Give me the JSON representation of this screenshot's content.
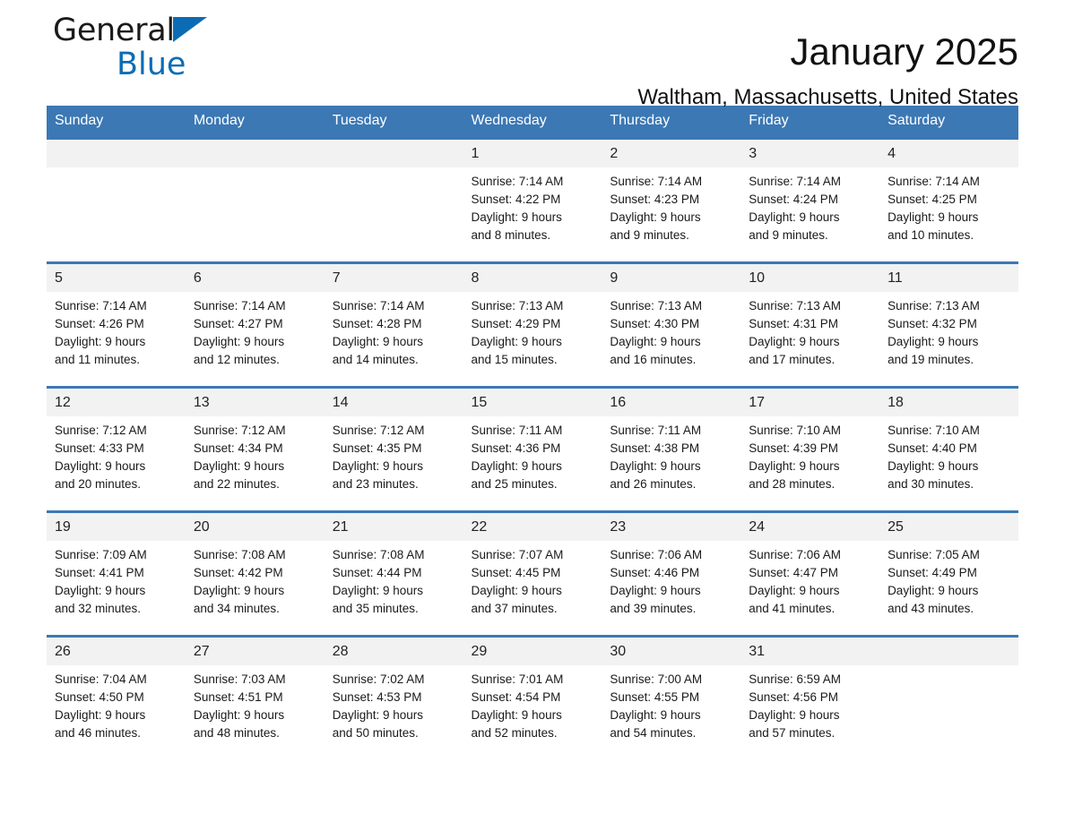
{
  "brand": {
    "name_part1": "General",
    "name_part2": "Blue",
    "triangle_color": "#0b6cb5"
  },
  "header": {
    "title": "January 2025",
    "location": "Waltham, Massachusetts, United States",
    "accent_color": "#3b78b4"
  },
  "calendar": {
    "weekday_headers": [
      "Sunday",
      "Monday",
      "Tuesday",
      "Wednesday",
      "Thursday",
      "Friday",
      "Saturday"
    ],
    "weeks": [
      [
        {
          "day": "",
          "lines": []
        },
        {
          "day": "",
          "lines": []
        },
        {
          "day": "",
          "lines": []
        },
        {
          "day": "1",
          "lines": [
            "Sunrise: 7:14 AM",
            "Sunset: 4:22 PM",
            "Daylight: 9 hours",
            "and 8 minutes."
          ]
        },
        {
          "day": "2",
          "lines": [
            "Sunrise: 7:14 AM",
            "Sunset: 4:23 PM",
            "Daylight: 9 hours",
            "and 9 minutes."
          ]
        },
        {
          "day": "3",
          "lines": [
            "Sunrise: 7:14 AM",
            "Sunset: 4:24 PM",
            "Daylight: 9 hours",
            "and 9 minutes."
          ]
        },
        {
          "day": "4",
          "lines": [
            "Sunrise: 7:14 AM",
            "Sunset: 4:25 PM",
            "Daylight: 9 hours",
            "and 10 minutes."
          ]
        }
      ],
      [
        {
          "day": "5",
          "lines": [
            "Sunrise: 7:14 AM",
            "Sunset: 4:26 PM",
            "Daylight: 9 hours",
            "and 11 minutes."
          ]
        },
        {
          "day": "6",
          "lines": [
            "Sunrise: 7:14 AM",
            "Sunset: 4:27 PM",
            "Daylight: 9 hours",
            "and 12 minutes."
          ]
        },
        {
          "day": "7",
          "lines": [
            "Sunrise: 7:14 AM",
            "Sunset: 4:28 PM",
            "Daylight: 9 hours",
            "and 14 minutes."
          ]
        },
        {
          "day": "8",
          "lines": [
            "Sunrise: 7:13 AM",
            "Sunset: 4:29 PM",
            "Daylight: 9 hours",
            "and 15 minutes."
          ]
        },
        {
          "day": "9",
          "lines": [
            "Sunrise: 7:13 AM",
            "Sunset: 4:30 PM",
            "Daylight: 9 hours",
            "and 16 minutes."
          ]
        },
        {
          "day": "10",
          "lines": [
            "Sunrise: 7:13 AM",
            "Sunset: 4:31 PM",
            "Daylight: 9 hours",
            "and 17 minutes."
          ]
        },
        {
          "day": "11",
          "lines": [
            "Sunrise: 7:13 AM",
            "Sunset: 4:32 PM",
            "Daylight: 9 hours",
            "and 19 minutes."
          ]
        }
      ],
      [
        {
          "day": "12",
          "lines": [
            "Sunrise: 7:12 AM",
            "Sunset: 4:33 PM",
            "Daylight: 9 hours",
            "and 20 minutes."
          ]
        },
        {
          "day": "13",
          "lines": [
            "Sunrise: 7:12 AM",
            "Sunset: 4:34 PM",
            "Daylight: 9 hours",
            "and 22 minutes."
          ]
        },
        {
          "day": "14",
          "lines": [
            "Sunrise: 7:12 AM",
            "Sunset: 4:35 PM",
            "Daylight: 9 hours",
            "and 23 minutes."
          ]
        },
        {
          "day": "15",
          "lines": [
            "Sunrise: 7:11 AM",
            "Sunset: 4:36 PM",
            "Daylight: 9 hours",
            "and 25 minutes."
          ]
        },
        {
          "day": "16",
          "lines": [
            "Sunrise: 7:11 AM",
            "Sunset: 4:38 PM",
            "Daylight: 9 hours",
            "and 26 minutes."
          ]
        },
        {
          "day": "17",
          "lines": [
            "Sunrise: 7:10 AM",
            "Sunset: 4:39 PM",
            "Daylight: 9 hours",
            "and 28 minutes."
          ]
        },
        {
          "day": "18",
          "lines": [
            "Sunrise: 7:10 AM",
            "Sunset: 4:40 PM",
            "Daylight: 9 hours",
            "and 30 minutes."
          ]
        }
      ],
      [
        {
          "day": "19",
          "lines": [
            "Sunrise: 7:09 AM",
            "Sunset: 4:41 PM",
            "Daylight: 9 hours",
            "and 32 minutes."
          ]
        },
        {
          "day": "20",
          "lines": [
            "Sunrise: 7:08 AM",
            "Sunset: 4:42 PM",
            "Daylight: 9 hours",
            "and 34 minutes."
          ]
        },
        {
          "day": "21",
          "lines": [
            "Sunrise: 7:08 AM",
            "Sunset: 4:44 PM",
            "Daylight: 9 hours",
            "and 35 minutes."
          ]
        },
        {
          "day": "22",
          "lines": [
            "Sunrise: 7:07 AM",
            "Sunset: 4:45 PM",
            "Daylight: 9 hours",
            "and 37 minutes."
          ]
        },
        {
          "day": "23",
          "lines": [
            "Sunrise: 7:06 AM",
            "Sunset: 4:46 PM",
            "Daylight: 9 hours",
            "and 39 minutes."
          ]
        },
        {
          "day": "24",
          "lines": [
            "Sunrise: 7:06 AM",
            "Sunset: 4:47 PM",
            "Daylight: 9 hours",
            "and 41 minutes."
          ]
        },
        {
          "day": "25",
          "lines": [
            "Sunrise: 7:05 AM",
            "Sunset: 4:49 PM",
            "Daylight: 9 hours",
            "and 43 minutes."
          ]
        }
      ],
      [
        {
          "day": "26",
          "lines": [
            "Sunrise: 7:04 AM",
            "Sunset: 4:50 PM",
            "Daylight: 9 hours",
            "and 46 minutes."
          ]
        },
        {
          "day": "27",
          "lines": [
            "Sunrise: 7:03 AM",
            "Sunset: 4:51 PM",
            "Daylight: 9 hours",
            "and 48 minutes."
          ]
        },
        {
          "day": "28",
          "lines": [
            "Sunrise: 7:02 AM",
            "Sunset: 4:53 PM",
            "Daylight: 9 hours",
            "and 50 minutes."
          ]
        },
        {
          "day": "29",
          "lines": [
            "Sunrise: 7:01 AM",
            "Sunset: 4:54 PM",
            "Daylight: 9 hours",
            "and 52 minutes."
          ]
        },
        {
          "day": "30",
          "lines": [
            "Sunrise: 7:00 AM",
            "Sunset: 4:55 PM",
            "Daylight: 9 hours",
            "and 54 minutes."
          ]
        },
        {
          "day": "31",
          "lines": [
            "Sunrise: 6:59 AM",
            "Sunset: 4:56 PM",
            "Daylight: 9 hours",
            "and 57 minutes."
          ]
        },
        {
          "day": "",
          "lines": []
        }
      ]
    ]
  }
}
